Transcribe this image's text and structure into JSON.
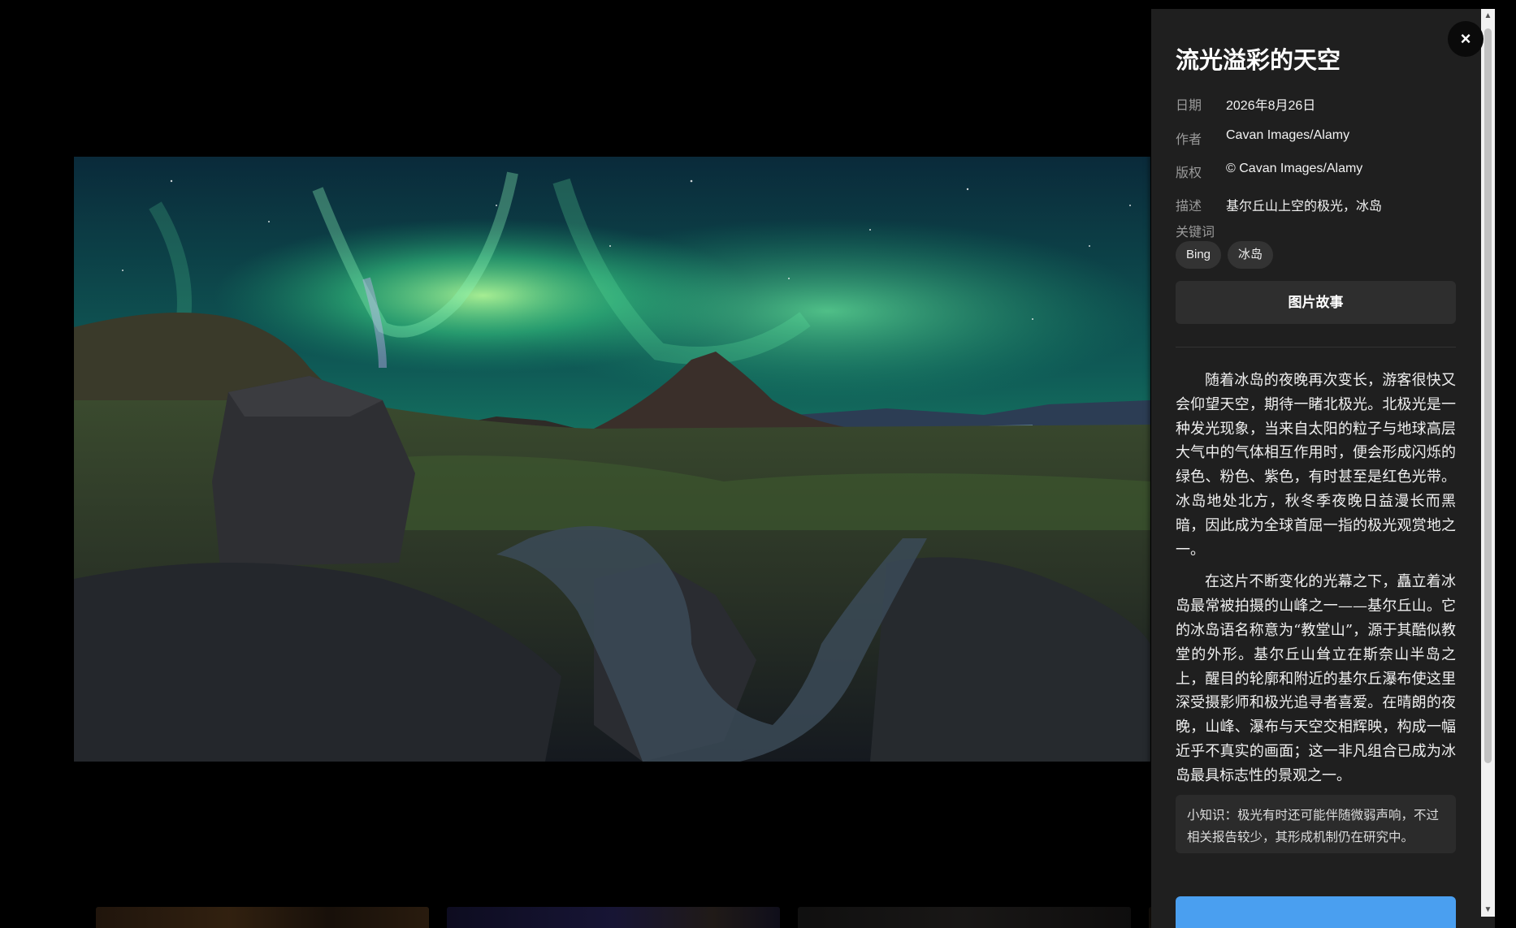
{
  "detail": {
    "title": "流光溢彩的天空",
    "meta": [
      {
        "label": "日期",
        "value": "2026年8月26日"
      },
      {
        "label": "作者",
        "value": "Cavan Images/Alamy"
      },
      {
        "label": "版权",
        "value": "© Cavan Images/Alamy"
      },
      {
        "label": "描述",
        "value": "基尔丘山上空的极光，冰岛"
      }
    ],
    "keywords_label": "关键词",
    "keywords": [
      "Bing",
      "冰岛"
    ],
    "story_button": "图片故事",
    "story": [
      "随着冰岛的夜晚再次变长，游客很快又会仰望天空，期待一睹北极光。北极光是一种发光现象，当来自太阳的粒子与地球高层大气中的气体相互作用时，便会形成闪烁的绿色、粉色、紫色，有时甚至是红色光带。冰岛地处北方，秋冬季夜晚日益漫长而黑暗，因此成为全球首屈一指的极光观赏地之一。",
      "在这片不断变化的光幕之下，矗立着冰岛最常被拍摄的山峰之一——基尔丘山。它的冰岛语名称意为“教堂山”，源于其酷似教堂的外形。基尔丘山耸立在斯奈山半岛之上，醒目的轮廓和附近的基尔丘瀑布使这里深受摄影师和极光追寻者喜爱。在晴朗的夜晚，山峰、瀑布与天空交相辉映，构成一幅近乎不真实的画面；这一非凡组合已成为冰岛最具标志性的景观之一。"
    ],
    "tip": "小知识：极光有时还可能伴随微弱声响，不过相关报告较少，其形成机制仍在研究中。",
    "close_symbol": "×"
  },
  "scrollbar": {
    "up": "▲",
    "down": "▼"
  },
  "colors": {
    "panel": "#1f1f1f",
    "accent": "#4a9ff0",
    "aurora": "#2fd08a"
  }
}
